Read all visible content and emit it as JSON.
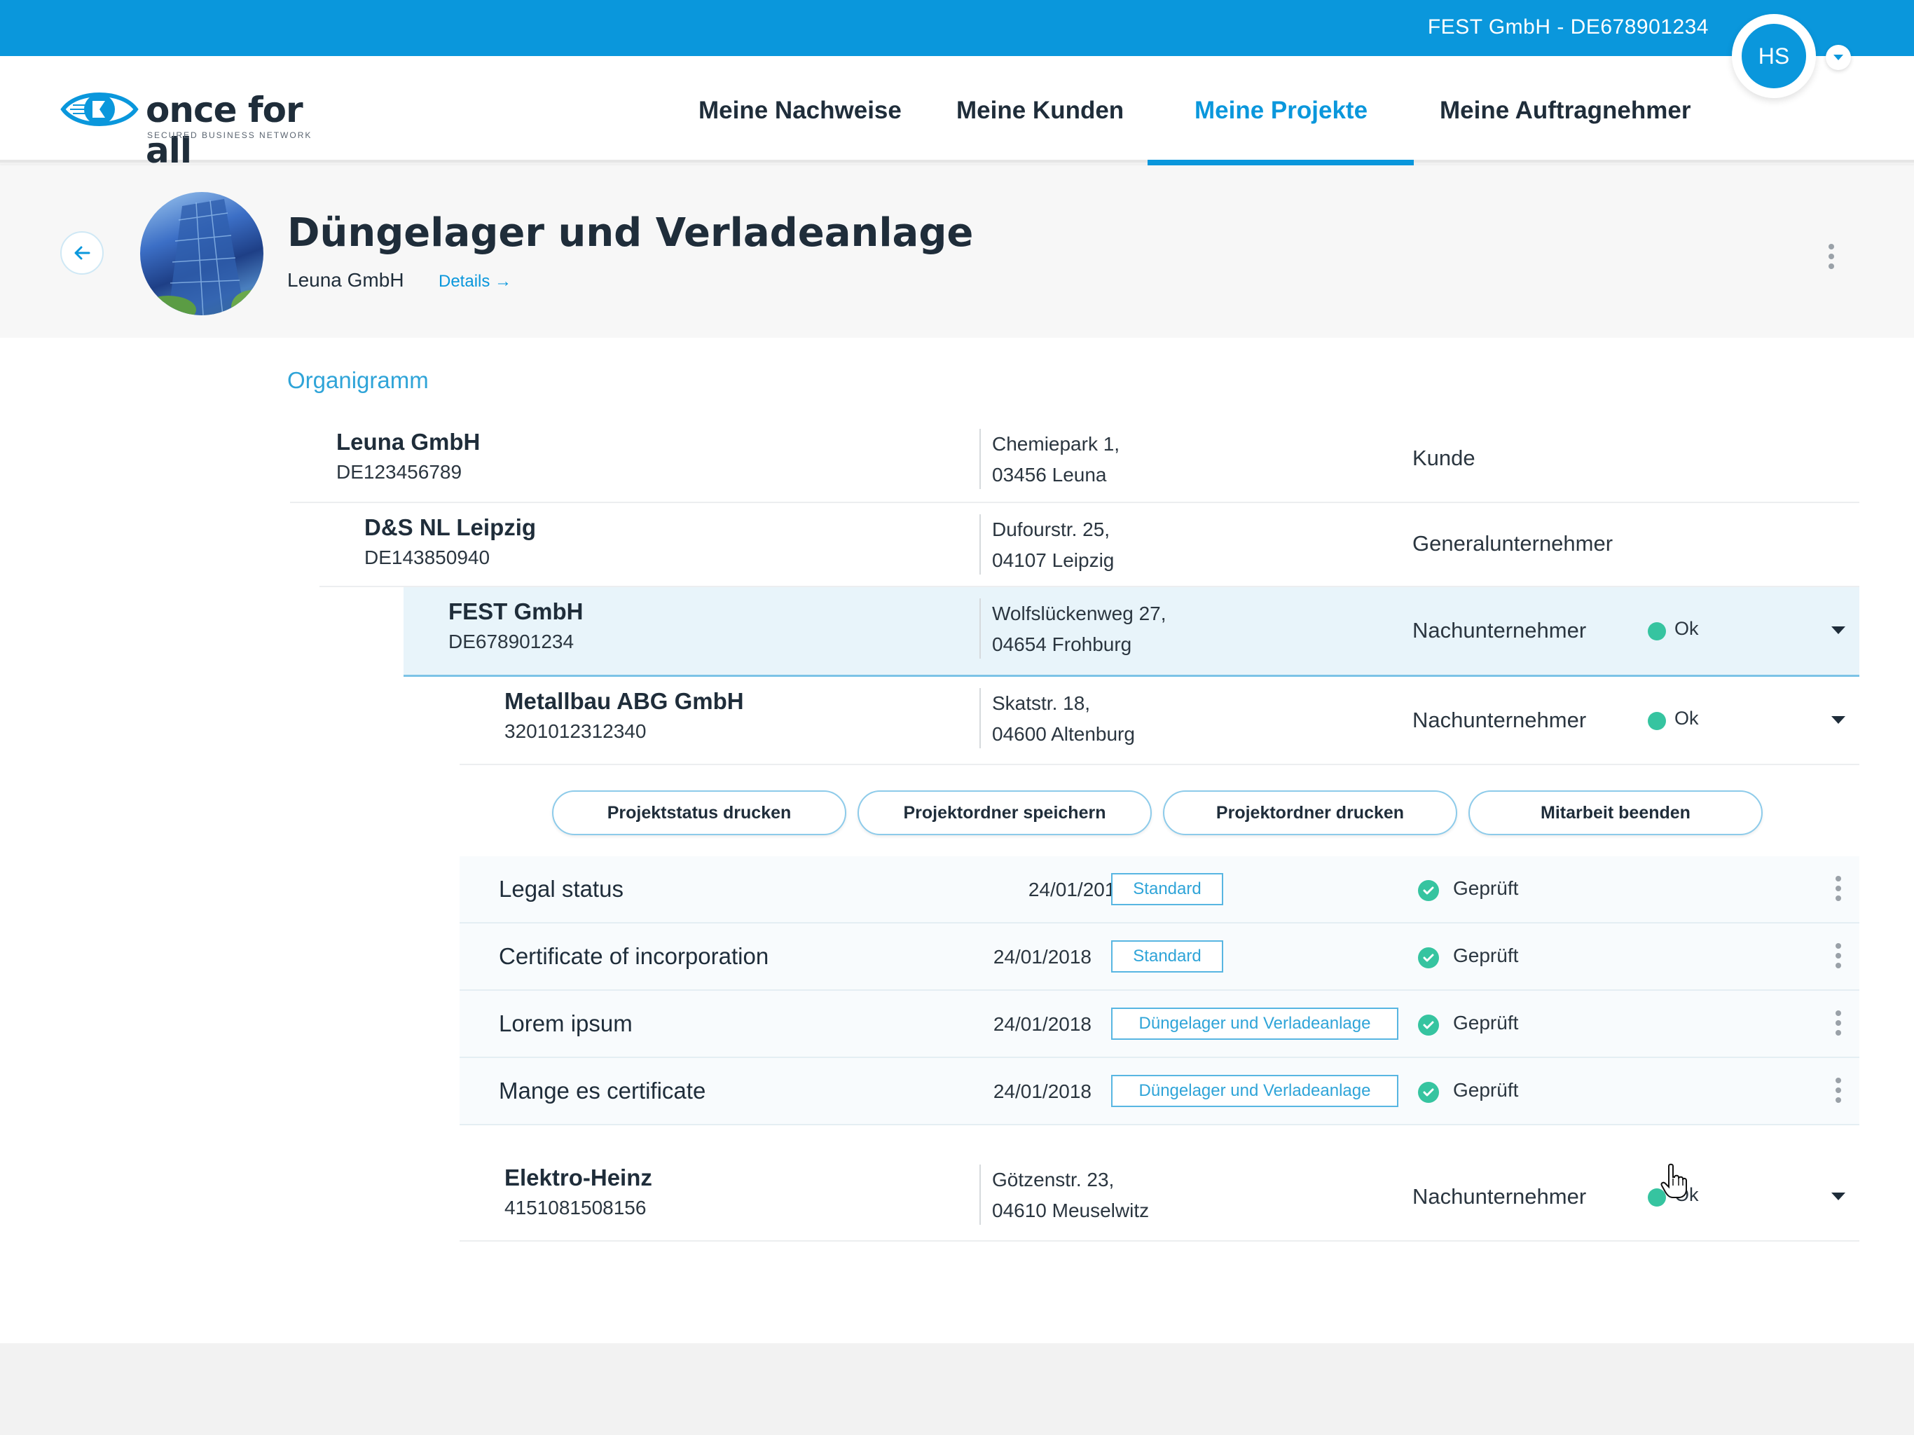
{
  "topbar": {
    "company": "FEST GmbH - DE678901234",
    "avatar_initials": "HS"
  },
  "brand": {
    "name": "once for all",
    "tagline": "SECURED BUSINESS NETWORK"
  },
  "nav": {
    "items": [
      {
        "label": "Meine Nachweise",
        "active": false
      },
      {
        "label": "Meine Kunden",
        "active": false
      },
      {
        "label": "Meine Projekte",
        "active": true
      },
      {
        "label": "Meine Auftragnehmer",
        "active": false
      }
    ]
  },
  "project": {
    "title": "Düngelager und Verladeanlage",
    "client": "Leuna GmbH",
    "details_label": "Details →"
  },
  "organigram": {
    "title": "Organigramm",
    "rows": [
      {
        "name": "Leuna GmbH",
        "id": "DE123456789",
        "street": "Chemiepark 1,",
        "city": "03456 Leuna",
        "role": "Kunde"
      },
      {
        "name": "D&S NL Leipzig",
        "id": "DE143850940",
        "street": "Dufourstr. 25,",
        "city": "04107 Leipzig",
        "role": "Generalunternehmer"
      },
      {
        "name": "FEST GmbH",
        "id": "DE678901234",
        "street": "Wolfslückenweg 27,",
        "city": "04654 Frohburg",
        "role": "Nachunternehmer",
        "status": "Ok"
      },
      {
        "name": "Metallbau ABG GmbH",
        "id": "3201012312340",
        "street": "Skatstr. 18,",
        "city": "04600 Altenburg",
        "role": "Nachunternehmer",
        "status": "Ok"
      },
      {
        "name": "Elektro-Heinz",
        "id": "4151081508156",
        "street": "Götzenstr. 23,",
        "city": "04610 Meuselwitz",
        "role": "Nachunternehmer",
        "status": "Ok"
      }
    ]
  },
  "actions": [
    "Projektstatus drucken",
    "Projektordner speichern",
    "Projektordner drucken",
    "Mitarbeit beenden"
  ],
  "documents": [
    {
      "name": "Legal status",
      "date": "24/01/2018",
      "tag": "Standard",
      "status": "Geprüft"
    },
    {
      "name": "Certificate of incorporation",
      "date": "24/01/2018",
      "tag": "Standard",
      "status": "Geprüft"
    },
    {
      "name": "Lorem ipsum",
      "date": "24/01/2018",
      "tag": "Düngelager und Verladeanlage",
      "status": "Geprüft"
    },
    {
      "name": "Mange es certificate",
      "date": "24/01/2018",
      "tag": "Düngelager und Verladeanlage",
      "status": "Geprüft"
    }
  ],
  "colors": {
    "accent": "#0a97dc",
    "status_ok": "#36c4a0",
    "highlight_row": "#e8f4fa"
  }
}
